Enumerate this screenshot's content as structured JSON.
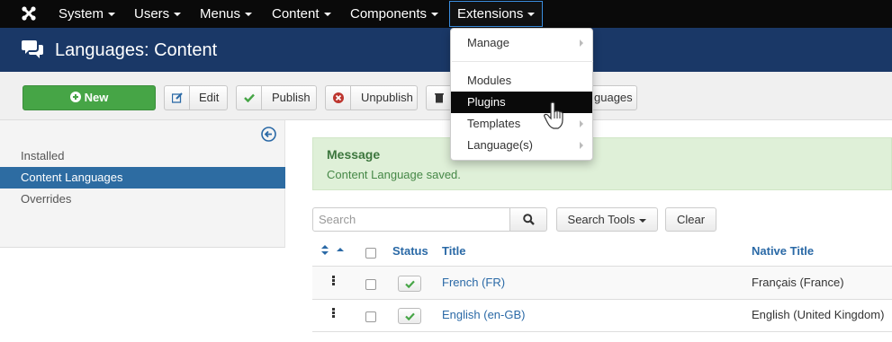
{
  "topbar": {
    "menus": [
      {
        "label": "System"
      },
      {
        "label": "Users"
      },
      {
        "label": "Menus"
      },
      {
        "label": "Content"
      },
      {
        "label": "Components"
      },
      {
        "label": "Extensions"
      }
    ]
  },
  "header": {
    "title": "Languages: Content",
    "icon": "comments-icon"
  },
  "toolbar": {
    "new_label": "New",
    "edit_label": "Edit",
    "publish_label": "Publish",
    "unpublish_label": "Unpublish",
    "partial_label": "guages"
  },
  "sidebar": {
    "items": [
      {
        "label": "Installed"
      },
      {
        "label": "Content Languages"
      },
      {
        "label": "Overrides"
      }
    ]
  },
  "message": {
    "title": "Message",
    "text": "Content Language saved."
  },
  "search": {
    "placeholder": "Search",
    "tools_label": "Search Tools",
    "clear_label": "Clear"
  },
  "table": {
    "headers": {
      "status": "Status",
      "title": "Title",
      "native_title": "Native Title"
    },
    "rows": [
      {
        "title": "French (FR)",
        "native_title": "Français (France)"
      },
      {
        "title": "English (en-GB)",
        "native_title": "English (United Kingdom)"
      }
    ]
  },
  "dropdown": {
    "items": [
      {
        "label": "Manage"
      },
      {
        "label": "Modules"
      },
      {
        "label": "Plugins"
      },
      {
        "label": "Templates"
      },
      {
        "label": "Language(s)"
      }
    ]
  },
  "colors": {
    "topbar": "#0a0a0a",
    "header": "#1a3867",
    "new_button": "#46a546",
    "active_sidebar": "#2d6ca2",
    "message_bg": "#dff0d8",
    "link": "#2a69a6"
  }
}
